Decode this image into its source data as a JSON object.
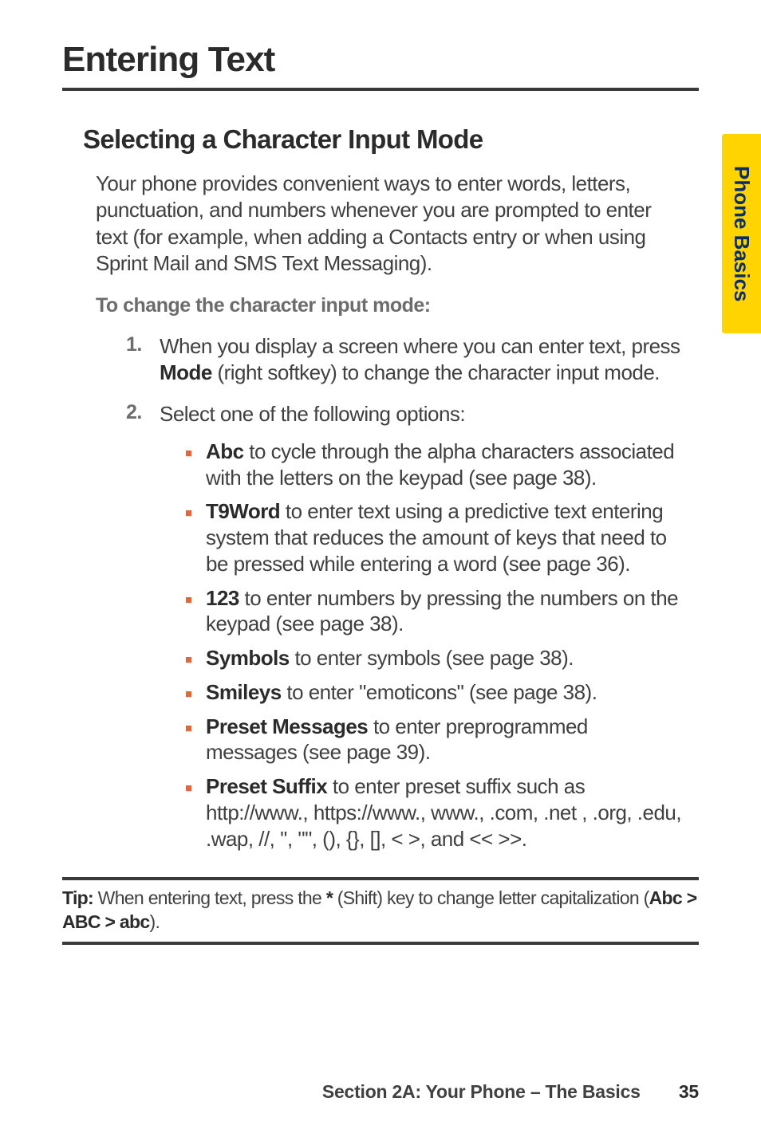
{
  "tab": {
    "label": "Phone Basics"
  },
  "title": "Entering Text",
  "subtitle": "Selecting a Character Input Mode",
  "intro": "Your phone provides convenient ways to enter words, letters, punctuation, and numbers whenever you are prompted to enter text (for example, when adding a Contacts entry or when using Sprint Mail and SMS Text Messaging).",
  "lead": "To change the character input mode:",
  "steps": {
    "n1": "1.",
    "b1a": "When you display a screen where you can enter text, press ",
    "b1mode": "Mode",
    "b1b": " (right softkey) to change the character input mode.",
    "n2": "2.",
    "b2": "Select one of the following options:"
  },
  "opts": {
    "abc_b": "Abc",
    "abc_t": " to cycle through the alpha characters associated with the letters on the keypad (see page 38).",
    "t9_b": "T9Word",
    "t9_t": " to enter text using a predictive text entering system that reduces the amount of keys that need to be pressed while entering a word (see page 36).",
    "num_b": "123",
    "num_t": " to enter numbers by pressing the numbers on the keypad (see page 38).",
    "sym_b": "Symbols",
    "sym_t": " to enter symbols (see page 38).",
    "smi_b": "Smileys",
    "smi_t": " to enter \"emoticons\" (see page 38).",
    "pm_b": "Preset Messages",
    "pm_t": " to enter preprogrammed messages (see page 39).",
    "ps_b": "Preset Suffix",
    "ps_t": "  to enter preset suffix such as http://www., https://www., www., .com, .net , .org, .edu, .wap, //, '', \"\", (), {}, [], < >, and << >>."
  },
  "tip": {
    "label": "Tip:",
    "t1": " When entering text, press the ",
    "star": "*",
    "t2": " (Shift) key to change letter capitalization (",
    "seq": "Abc > ABC > abc",
    "t3": ")."
  },
  "footer": {
    "section": "Section 2A: Your Phone – The Basics",
    "page": "35"
  }
}
